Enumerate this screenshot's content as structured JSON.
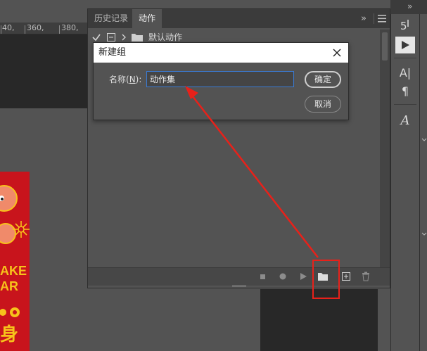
{
  "ruler": {
    "labels": [
      "40,",
      "360,",
      "380,"
    ]
  },
  "panel": {
    "tabs": [
      {
        "label": "历史记录",
        "active": false
      },
      {
        "label": "动作",
        "active": true
      }
    ],
    "collapse_glyph": "»",
    "menu_icon": "hamburger-menu-icon",
    "action_set": {
      "name": "默认动作",
      "checked": true
    },
    "bottom_icons": [
      "stop-icon",
      "record-icon",
      "play-icon",
      "new-set-folder-icon",
      "new-action-icon",
      "trash-icon"
    ]
  },
  "dialog": {
    "title": "新建组",
    "field_label": "名称(",
    "field_label_key": "N",
    "field_label_tail": "):",
    "name_value": "动作集",
    "ok_label": "确定",
    "cancel_label": "取消"
  },
  "poster": {
    "line1": "AKE",
    "line2": "AR",
    "glyph": "身"
  },
  "right_tools": {
    "char_label": "A|",
    "para_label": "¶",
    "glyph_label": "A"
  },
  "colors": {
    "annotation_red": "#e8211a",
    "poster_red": "#c8141c",
    "poster_gold": "#f7c21b",
    "input_focus": "#3a7bd5"
  }
}
